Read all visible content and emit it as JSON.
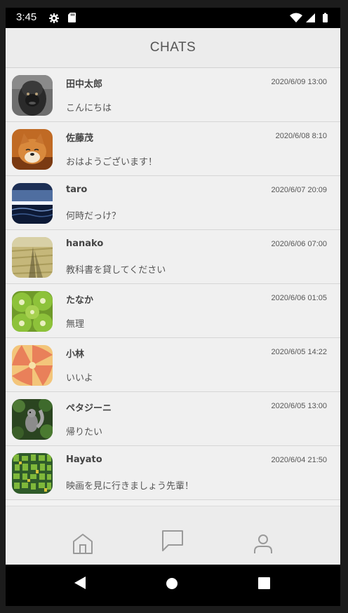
{
  "status_bar": {
    "time": "3:45",
    "icons": [
      "gear-icon",
      "sd-card-icon",
      "wifi-icon",
      "cell-signal-icon",
      "battery-icon"
    ]
  },
  "app_bar": {
    "title": "CHATS"
  },
  "chats": [
    {
      "name": "田中太郎",
      "timestamp": "2020/6/09 13:00",
      "message": "こんにちは",
      "avatar": "gorilla"
    },
    {
      "name": "佐藤茂",
      "timestamp": "2020/6/08 8:10",
      "message": "おはようございます！",
      "avatar": "shiba-dog"
    },
    {
      "name": "taro",
      "timestamp": "2020/6/07 20:09",
      "message": "何時だっけ？",
      "avatar": "ocean-sunset"
    },
    {
      "name": "hanako",
      "timestamp": "2020/6/06 07:00",
      "message": "教科書を貸してください",
      "avatar": "field-shadow"
    },
    {
      "name": "たなか",
      "timestamp": "2020/6/06 01:05",
      "message": "無理",
      "avatar": "kiwi"
    },
    {
      "name": "小林",
      "timestamp": "2020/6/05 14:22",
      "message": "いいよ",
      "avatar": "swirl"
    },
    {
      "name": "ペタジーニ",
      "timestamp": "2020/6/05 13:00",
      "message": "帰りたい",
      "avatar": "squirrel"
    },
    {
      "name": "Hayato",
      "timestamp": "2020/6/04 21:50",
      "message": "映画を見に行きましょう先輩！",
      "avatar": "green-mosaic"
    }
  ],
  "bottom_nav": [
    "home-icon",
    "chat-icon",
    "profile-icon"
  ],
  "android_nav": [
    "back-icon",
    "home-circle-icon",
    "recents-icon"
  ]
}
